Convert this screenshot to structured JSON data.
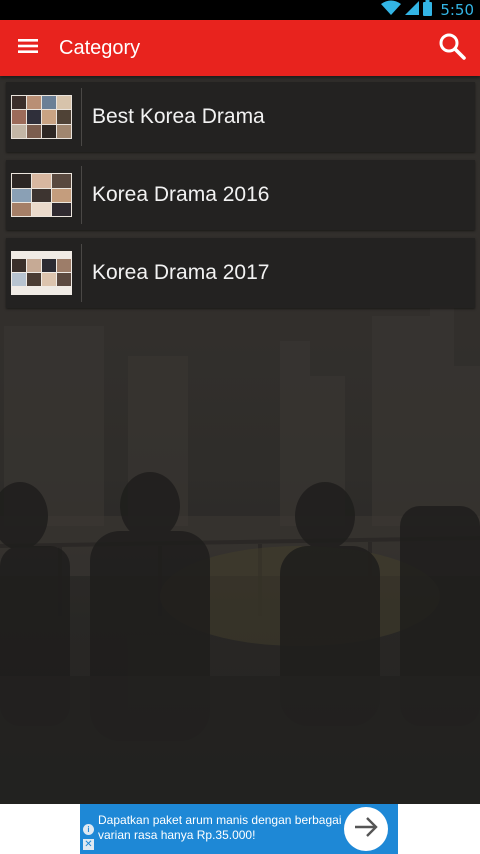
{
  "status_bar": {
    "time": "5:50",
    "icons": [
      "wifi-icon",
      "signal-icon",
      "battery-icon"
    ]
  },
  "app_bar": {
    "menu_icon": "menu-icon",
    "title": "Category",
    "search_icon": "search-icon",
    "color": "#e8231e"
  },
  "categories": [
    {
      "label": "Best Korea Drama",
      "thumbnail": "drama-collage-thumbnail"
    },
    {
      "label": "Korea Drama 2016",
      "thumbnail": "drama-collage-thumbnail"
    },
    {
      "label": "Korea Drama 2017",
      "thumbnail": "drama-collage-thumbnail"
    }
  ],
  "ad": {
    "text": "Dapatkan paket arum manis dengan berbagai varian rasa hanya Rp.35.000!",
    "info_glyph": "i",
    "close_glyph": "✕",
    "arrow_icon": "arrow-right-icon",
    "color": "#1e88d6"
  },
  "background": "city-skyline-people-photo"
}
